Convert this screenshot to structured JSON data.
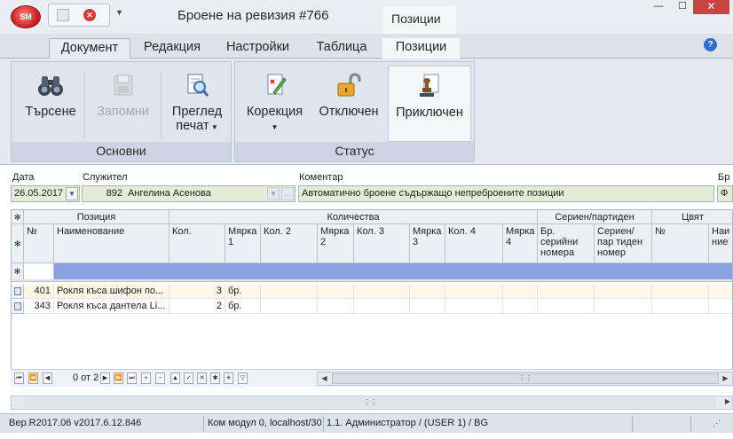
{
  "app": {
    "logo_text": "SM",
    "title": "Броене на ревизия #766",
    "context_title": "Позиции"
  },
  "tabs": [
    "Документ",
    "Редакция",
    "Настройки",
    "Таблица",
    "Позиции"
  ],
  "ribbon": {
    "groups": [
      {
        "label": "Основни"
      },
      {
        "label": "Статус"
      }
    ],
    "buttons": {
      "search": "Търсене",
      "save": "Запомни",
      "preview_line1": "Преглед",
      "preview_line2": "печат",
      "correction": "Корекция",
      "unlocked": "Отключен",
      "completed": "Приключен"
    }
  },
  "form": {
    "date_label": "Дата",
    "date_value": "26.05.2017",
    "employee_label": "Служител",
    "employee_code": "892",
    "employee_name": "Ангелина Асенова",
    "comment_label": "Коментар",
    "comment_value": "Автоматично броене съдържащо непреброените позиции",
    "extra_label": "Бр",
    "extra_value": "Ф"
  },
  "grid": {
    "band_headers": [
      "Позиция",
      "Количества",
      "Сериен/партиден номер",
      "Цвят"
    ],
    "columns": [
      "№",
      "Наименование",
      "Кол.",
      "Мярка 1",
      "Кол. 2",
      "Мярка 2",
      "Кол. 3",
      "Мярка 3",
      "Кол. 4",
      "Мярка 4",
      "Бр. серийни номера",
      "Сериен/пар тиден номер",
      "№",
      "Наи ние"
    ],
    "rows": [
      {
        "no": "401",
        "name": "Рокля къса шифон по...",
        "qty": "3",
        "unit": "бр."
      },
      {
        "no": "343",
        "name": "Рокля къса дантела Li...",
        "qty": "2",
        "unit": "бр."
      }
    ]
  },
  "navigator": {
    "record_text": "0 от 2"
  },
  "status": {
    "version": "Вер.R2017.06 v2017.6.12.846",
    "module": "Ком модул 0, localhost/30",
    "user": "1.1. Администратор /  (USER 1) / BG"
  },
  "colors": {
    "field_bg": "#e3edd6",
    "new_row": "#8aa2df",
    "close": "#c84343",
    "help": "#2c6fcc"
  }
}
